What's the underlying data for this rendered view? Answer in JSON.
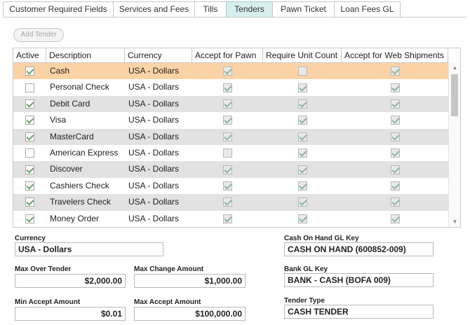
{
  "tabs": [
    {
      "label": "Customer Required Fields",
      "active": false
    },
    {
      "label": "Services and Fees",
      "active": false
    },
    {
      "label": "Tills",
      "active": false
    },
    {
      "label": "Tenders",
      "active": true
    },
    {
      "label": "Pawn Ticket",
      "active": false
    },
    {
      "label": "Loan Fees GL",
      "active": false
    }
  ],
  "add_tender_label": "Add Tender",
  "grid": {
    "columns": [
      "Active",
      "Description",
      "Currency",
      "Accept for Pawn",
      "Require Unit Count",
      "Accept for Web Shipments"
    ],
    "rows": [
      {
        "active": true,
        "description": "Cash",
        "currency": "USA - Dollars",
        "pawn": true,
        "unit_count": false,
        "web": true
      },
      {
        "active": false,
        "description": "Personal Check",
        "currency": "USA - Dollars",
        "pawn": true,
        "unit_count": true,
        "web": true
      },
      {
        "active": true,
        "description": "Debit Card",
        "currency": "USA - Dollars",
        "pawn": true,
        "unit_count": true,
        "web": true
      },
      {
        "active": true,
        "description": "Visa",
        "currency": "USA - Dollars",
        "pawn": true,
        "unit_count": true,
        "web": true
      },
      {
        "active": true,
        "description": "MasterCard",
        "currency": "USA - Dollars",
        "pawn": true,
        "unit_count": true,
        "web": true
      },
      {
        "active": false,
        "description": "American Express",
        "currency": "USA - Dollars",
        "pawn": false,
        "unit_count": true,
        "web": true
      },
      {
        "active": true,
        "description": "Discover",
        "currency": "USA - Dollars",
        "pawn": true,
        "unit_count": true,
        "web": true
      },
      {
        "active": true,
        "description": "Cashiers Check",
        "currency": "USA - Dollars",
        "pawn": true,
        "unit_count": true,
        "web": true
      },
      {
        "active": true,
        "description": "Travelers Check",
        "currency": "USA - Dollars",
        "pawn": true,
        "unit_count": true,
        "web": true
      },
      {
        "active": true,
        "description": "Money Order",
        "currency": "USA - Dollars",
        "pawn": true,
        "unit_count": true,
        "web": true
      }
    ]
  },
  "form": {
    "currency_label": "Currency",
    "currency_value": "USA - Dollars",
    "cash_on_hand_label": "Cash On Hand GL Key",
    "cash_on_hand_value": "CASH ON HAND (600852-009)",
    "max_over_tender_label": "Max Over Tender",
    "max_over_tender_value": "$2,000.00",
    "max_change_label": "Max Change Amount",
    "max_change_value": "$1,000.00",
    "bank_gl_label": "Bank GL Key",
    "bank_gl_value": "BANK - CASH (BOFA 009)",
    "min_accept_label": "Min Accept Amount",
    "min_accept_value": "$0.01",
    "max_accept_label": "Max Accept Amount",
    "max_accept_value": "$100,000.00",
    "tender_type_label": "Tender Type",
    "tender_type_value": "CASH TENDER"
  },
  "colors": {
    "active_tab": "#d7efee",
    "selected_row": "#fbd3a6",
    "alt_row": "#e2e2e2",
    "check": "#6aa276"
  },
  "icons": {
    "scroll_up": "chevron-up-icon",
    "scroll_down": "chevron-down-icon",
    "checkbox": "checkbox-icon"
  }
}
